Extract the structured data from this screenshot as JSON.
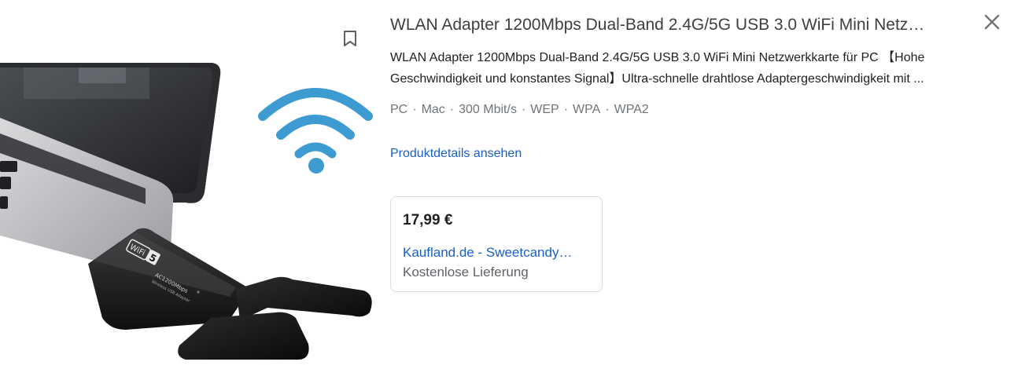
{
  "product": {
    "title": "WLAN Adapter 1200Mbps Dual-Band 2.4G/5G USB 3.0 WiFi Mini Netz…",
    "description_line1": "WLAN Adapter 1200Mbps Dual-Band 2.4G/5G USB 3.0 WiFi Mini Netzwerkkarte für PC 【Hohe",
    "description_line2": "Geschwindigkeit und konstantes Signal】Ultra-schnelle drahtlose Adaptergeschwindigkeit mit ...",
    "specs": [
      "PC",
      "Mac",
      "300 Mbit/s",
      "WEP",
      "WPA",
      "WPA2"
    ],
    "spec_separator": "·",
    "details_link": "Produktdetails ansehen",
    "image_text": {
      "wifi_badge": "WiFi",
      "wifi_badge_num": "5",
      "ac_label": "AC1200Mbps",
      "sub_label": "Wireless USB Adapter"
    }
  },
  "offer": {
    "price": "17,99 €",
    "seller": "Kaufland.de - Sweetcandy…",
    "shipping": "Kostenlose Lieferung"
  },
  "icons": {
    "bookmark": "bookmark-icon",
    "close": "close-icon",
    "wifi": "wifi-icon"
  },
  "colors": {
    "link": "#1a5fc8",
    "wifi_blue": "#3d9bd1"
  }
}
